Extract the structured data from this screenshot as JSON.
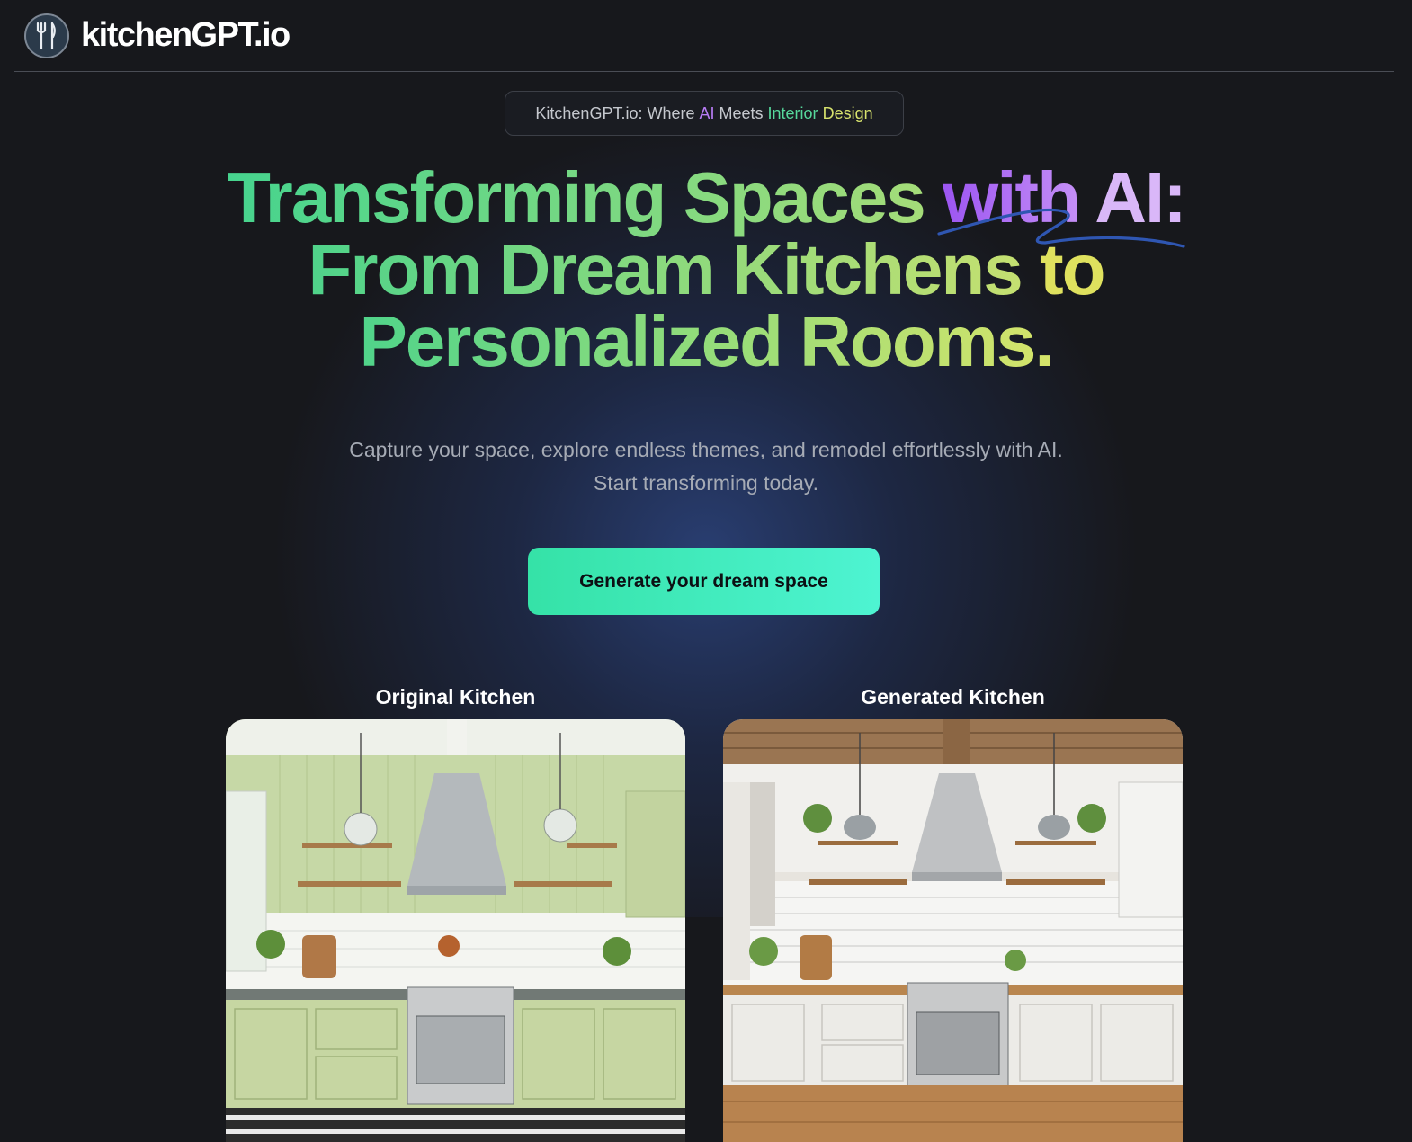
{
  "header": {
    "brand": "kitchenGPT.io",
    "logo_icon": "fork-knife-icon"
  },
  "badge": {
    "prefix": "KitchenGPT.io: Where ",
    "ai": "AI",
    "meets": " Meets ",
    "interior": "Interior",
    "design": " Design"
  },
  "hero": {
    "line1a": "Transforming Spaces ",
    "line1b": "with",
    "line1c": " AI:",
    "line2a": "From Dream Kitchens ",
    "line2b": "to",
    "line3": "Personalized Rooms."
  },
  "subtitle": "Capture your space, explore endless themes, and remodel effortlessly with AI. Start transforming today.",
  "cta": {
    "label": "Generate your dream space"
  },
  "comparison": {
    "original_label": "Original Kitchen",
    "generated_label": "Generated Kitchen"
  },
  "colors": {
    "accent": "#3ae6b4",
    "purple": "#b77cf5",
    "green": "#56d89c",
    "yellow": "#d7e26d",
    "background": "#17181c"
  }
}
